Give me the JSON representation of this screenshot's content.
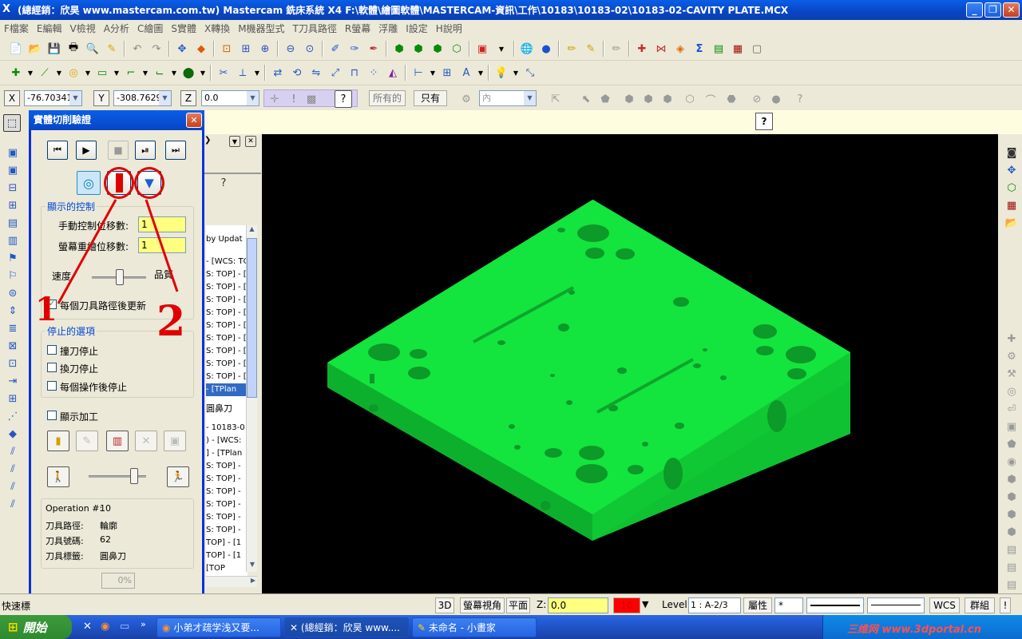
{
  "window": {
    "title": "(總經銷：欣昊 www.mastercam.com.tw) Mastercam 銑床系統 X4  F:\\軟體\\繪圖軟體\\MASTERCAM-資訊\\工作\\10183\\10183-02\\10183-02-CAVITY PLATE.MCX",
    "min": "_",
    "max": "❐",
    "close": "✕"
  },
  "menu": [
    "F檔案",
    "E編輯",
    "V檢視",
    "A分析",
    "C繪圖",
    "S實體",
    "X轉換",
    "M機器型式",
    "T刀具路徑",
    "R螢幕",
    "浮雕",
    "I設定",
    "H說明"
  ],
  "coord": {
    "x_label": "X",
    "x_value": "-76.70341",
    "y_label": "Y",
    "y_value": "-308.7629",
    "z_label": "Z",
    "z_value": "0.0",
    "all_btn": "所有的",
    "only_btn": "只有",
    "inside_value": "內"
  },
  "help_icon": "?",
  "dialog": {
    "title": "實體切削驗證",
    "close": "✕",
    "display_group": "顯示的控制",
    "manual_label": "手動控制位移數:",
    "manual_value": "1",
    "redraw_label": "螢幕重繪位移數:",
    "redraw_value": "1",
    "speed_label": "速度",
    "quality_label": "品質",
    "update_check_label": "每個刀具路徑後更新",
    "update_checked": "✓",
    "stop_group": "停止的選項",
    "stop_collision": "撞刀停止",
    "stop_toolchange": "換刀停止",
    "stop_each_op": "每個操作後停止",
    "show_machining": "顯示加工",
    "operation_label": "Operation #:",
    "operation_value": "10",
    "path_label": "刀具路徑:",
    "path_value": "輪廓",
    "toolno_label": "刀具號碼:",
    "toolno_value": "62",
    "toolname_label": "刀具標籤:",
    "toolname_value": "圓鼻刀",
    "progress": "0%",
    "ok": "✔",
    "cancel": "✖",
    "help": "?"
  },
  "manager": {
    "header_text": "by Updat",
    "rows": [
      "- [WCS: TOP] - [",
      "S: TOP] - [",
      "S: TOP] - [",
      "S: TOP] - [",
      "S: TOP] - [",
      "S: TOP] - [",
      "S: TOP] - [",
      "S: TOP] - [",
      "S: TOP] - [",
      "S: TOP] - [",
      "- [TPlan",
      "圓鼻刀",
      "",
      "- 10183-0",
      ") - [WCS:",
      "] - [TPlan",
      "S: TOP] -",
      "S: TOP] -",
      "S: TOP] -",
      "S: TOP] -",
      "S: TOP] -",
      "S: TOP] -",
      "TOP] - [1",
      "TOP] - [1",
      "[TOP"
    ]
  },
  "statusbar": {
    "quick": "快速標",
    "mode_3d": "3D",
    "screen_view": "螢幕視角",
    "plane": "平面",
    "z_label": "Z:",
    "z_value": "0.0",
    "color_value": "10",
    "level_label": "Level:",
    "level_value": "1 : A-2/3",
    "attr": "屬性",
    "wcs": "WCS",
    "group": "群組",
    "excl": "!",
    "point_style": "*"
  },
  "taskbar": {
    "start": "開始",
    "task1": "小弟才疏学浅又要...",
    "task2": "(總經銷：欣昊 www....",
    "task3": "未命名 - 小畫家",
    "tray_text": "三维网 www.3dportal.cn"
  },
  "annotations": {
    "one": "1",
    "two": "2"
  },
  "colors": {
    "part": "#11e63c",
    "viewport": "#000000",
    "annotation": "#e00000",
    "title_blue": "#0a5ee8"
  }
}
